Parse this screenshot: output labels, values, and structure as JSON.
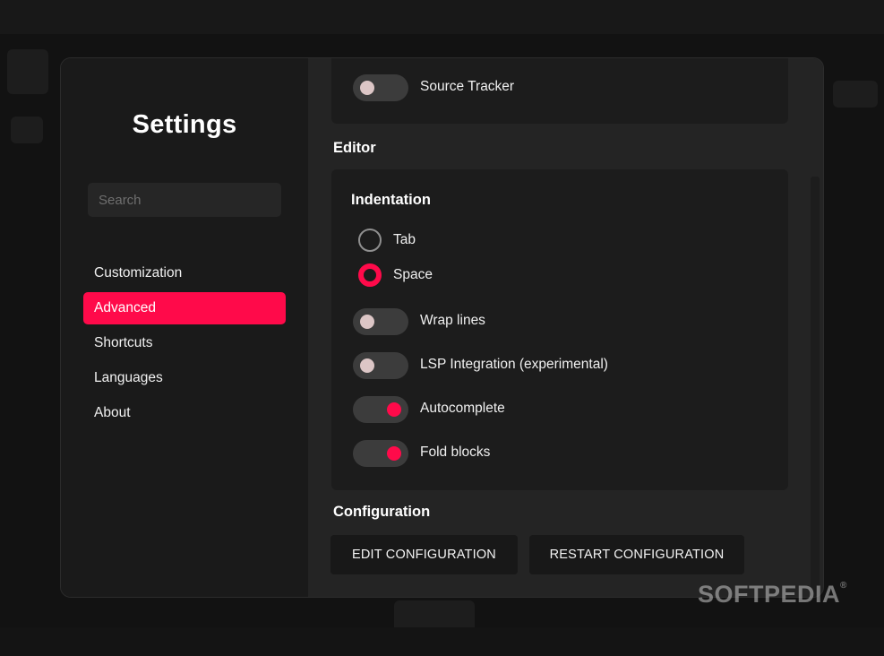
{
  "settings": {
    "title": "Settings",
    "search": {
      "placeholder": "Search",
      "value": ""
    },
    "nav": [
      {
        "label": "Customization",
        "active": false
      },
      {
        "label": "Advanced",
        "active": true
      },
      {
        "label": "Shortcuts",
        "active": false
      },
      {
        "label": "Languages",
        "active": false
      },
      {
        "label": "About",
        "active": false
      }
    ]
  },
  "content": {
    "source_tracker": {
      "label": "Source Tracker",
      "enabled": false
    },
    "editor": {
      "title": "Editor",
      "indentation": {
        "title": "Indentation",
        "options": [
          {
            "label": "Tab",
            "selected": false
          },
          {
            "label": "Space",
            "selected": true
          }
        ]
      },
      "toggles": [
        {
          "label": "Wrap lines",
          "enabled": false
        },
        {
          "label": "LSP Integration (experimental)",
          "enabled": false
        },
        {
          "label": "Autocomplete",
          "enabled": true
        },
        {
          "label": "Fold blocks",
          "enabled": true
        }
      ]
    },
    "configuration": {
      "title": "Configuration",
      "edit_label": "EDIT CONFIGURATION",
      "restart_label": "RESTART CONFIGURATION"
    }
  },
  "watermark": {
    "text": "SOFTPEDIA",
    "mark": "®"
  },
  "colors": {
    "accent": "#ff0a4a",
    "panel": "#242424",
    "sidebar": "#1a1a1a"
  }
}
